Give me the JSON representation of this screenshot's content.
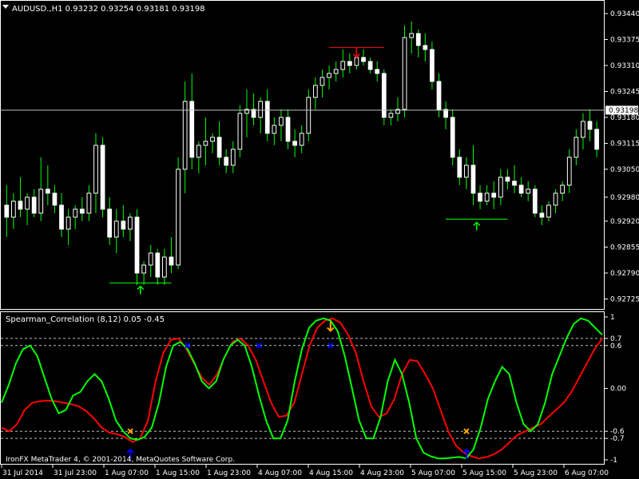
{
  "header": {
    "symbol_text": "AUDUSD.,H1  0.93232 0.93254 0.93181 0.93198"
  },
  "price_axis": {
    "ticks": [
      "0.93440",
      "0.93375",
      "0.93310",
      "0.93245",
      "0.93180",
      "0.93115",
      "0.93050",
      "0.92980",
      "0.92920",
      "0.92855",
      "0.92790",
      "0.92725"
    ],
    "current_price_label": "0.93198"
  },
  "indicator": {
    "title": "Spearman_Correlation (8,12) 0.05 -0.45",
    "level_labels": [
      "1",
      "0.7",
      "0.6",
      "0.00",
      "-0.6",
      "-0.7",
      "-1"
    ],
    "copyright": "IronFX MetaTrader 4, © 2001-2014, MetaQuotes Software Corp."
  },
  "time_axis": {
    "labels": [
      "31 Jul 2014",
      "31 Jul 23:00",
      "1 Aug 07:00",
      "1 Aug 15:00",
      "1 Aug 23:00",
      "4 Aug 07:00",
      "4 Aug 15:00",
      "4 Aug 23:00",
      "5 Aug 07:00",
      "5 Aug 15:00",
      "5 Aug 23:00",
      "6 Aug 07:00"
    ]
  },
  "colors": {
    "background": "#000000",
    "candle_bull": "#ffffff",
    "candle_bear": "#ffffff",
    "wick": "#00ff00",
    "grid_line": "#ffffff",
    "green_line": "#00ff00",
    "red_line": "#ff0000",
    "marker_blue": "#0000ff",
    "marker_orange": "#ffa500",
    "signal_green": "#00ff00",
    "signal_red": "#ff0000"
  },
  "chart_data": {
    "type": "candlestick",
    "symbol": "AUDUSD.",
    "timeframe": "H1",
    "ylim": [
      0.927,
      0.9347
    ],
    "current_price": 0.93198,
    "candles": [
      {
        "o": 0.9296,
        "h": 0.9301,
        "l": 0.9288,
        "c": 0.9293
      },
      {
        "o": 0.9293,
        "h": 0.9299,
        "l": 0.929,
        "c": 0.9297
      },
      {
        "o": 0.9297,
        "h": 0.9303,
        "l": 0.9293,
        "c": 0.9295
      },
      {
        "o": 0.9295,
        "h": 0.9299,
        "l": 0.9291,
        "c": 0.9298
      },
      {
        "o": 0.9298,
        "h": 0.93,
        "l": 0.9293,
        "c": 0.9294
      },
      {
        "o": 0.9294,
        "h": 0.9308,
        "l": 0.9292,
        "c": 0.93
      },
      {
        "o": 0.93,
        "h": 0.9306,
        "l": 0.9296,
        "c": 0.9299
      },
      {
        "o": 0.9299,
        "h": 0.9301,
        "l": 0.9294,
        "c": 0.9296
      },
      {
        "o": 0.9296,
        "h": 0.9299,
        "l": 0.9288,
        "c": 0.929
      },
      {
        "o": 0.929,
        "h": 0.9295,
        "l": 0.9286,
        "c": 0.9293
      },
      {
        "o": 0.9293,
        "h": 0.9296,
        "l": 0.929,
        "c": 0.9295
      },
      {
        "o": 0.9295,
        "h": 0.9298,
        "l": 0.9292,
        "c": 0.9294
      },
      {
        "o": 0.9294,
        "h": 0.9301,
        "l": 0.9292,
        "c": 0.9299
      },
      {
        "o": 0.9299,
        "h": 0.9314,
        "l": 0.9294,
        "c": 0.9311
      },
      {
        "o": 0.9311,
        "h": 0.9313,
        "l": 0.9293,
        "c": 0.9295
      },
      {
        "o": 0.9295,
        "h": 0.9298,
        "l": 0.9286,
        "c": 0.9288
      },
      {
        "o": 0.9288,
        "h": 0.9295,
        "l": 0.9284,
        "c": 0.9292
      },
      {
        "o": 0.9292,
        "h": 0.9296,
        "l": 0.9288,
        "c": 0.929
      },
      {
        "o": 0.929,
        "h": 0.9294,
        "l": 0.9287,
        "c": 0.9293
      },
      {
        "o": 0.9293,
        "h": 0.9295,
        "l": 0.9276,
        "c": 0.9279
      },
      {
        "o": 0.9279,
        "h": 0.9282,
        "l": 0.9276,
        "c": 0.9281
      },
      {
        "o": 0.9281,
        "h": 0.9286,
        "l": 0.9278,
        "c": 0.9284
      },
      {
        "o": 0.9284,
        "h": 0.9285,
        "l": 0.9276,
        "c": 0.9278
      },
      {
        "o": 0.9278,
        "h": 0.9285,
        "l": 0.9276,
        "c": 0.9283
      },
      {
        "o": 0.9283,
        "h": 0.9288,
        "l": 0.9279,
        "c": 0.9281
      },
      {
        "o": 0.9281,
        "h": 0.9308,
        "l": 0.928,
        "c": 0.9305
      },
      {
        "o": 0.9305,
        "h": 0.9327,
        "l": 0.9299,
        "c": 0.9322
      },
      {
        "o": 0.9322,
        "h": 0.9329,
        "l": 0.9305,
        "c": 0.9308
      },
      {
        "o": 0.9308,
        "h": 0.9312,
        "l": 0.9304,
        "c": 0.9311
      },
      {
        "o": 0.9311,
        "h": 0.9318,
        "l": 0.9306,
        "c": 0.9312
      },
      {
        "o": 0.9312,
        "h": 0.9314,
        "l": 0.9309,
        "c": 0.9313
      },
      {
        "o": 0.9313,
        "h": 0.9317,
        "l": 0.9306,
        "c": 0.9308
      },
      {
        "o": 0.9308,
        "h": 0.931,
        "l": 0.9304,
        "c": 0.9306
      },
      {
        "o": 0.9306,
        "h": 0.9312,
        "l": 0.9304,
        "c": 0.931
      },
      {
        "o": 0.931,
        "h": 0.9321,
        "l": 0.9308,
        "c": 0.9319
      },
      {
        "o": 0.9319,
        "h": 0.9325,
        "l": 0.9313,
        "c": 0.932
      },
      {
        "o": 0.932,
        "h": 0.9324,
        "l": 0.9316,
        "c": 0.9318
      },
      {
        "o": 0.9318,
        "h": 0.9323,
        "l": 0.9314,
        "c": 0.9322
      },
      {
        "o": 0.9322,
        "h": 0.9325,
        "l": 0.9312,
        "c": 0.9314
      },
      {
        "o": 0.9314,
        "h": 0.9318,
        "l": 0.9311,
        "c": 0.9316
      },
      {
        "o": 0.9316,
        "h": 0.932,
        "l": 0.9312,
        "c": 0.9318
      },
      {
        "o": 0.9318,
        "h": 0.932,
        "l": 0.931,
        "c": 0.9312
      },
      {
        "o": 0.9312,
        "h": 0.9315,
        "l": 0.9308,
        "c": 0.9311
      },
      {
        "o": 0.9311,
        "h": 0.9316,
        "l": 0.9309,
        "c": 0.9314
      },
      {
        "o": 0.9314,
        "h": 0.9325,
        "l": 0.9312,
        "c": 0.9323
      },
      {
        "o": 0.9323,
        "h": 0.9328,
        "l": 0.932,
        "c": 0.9326
      },
      {
        "o": 0.9326,
        "h": 0.933,
        "l": 0.9323,
        "c": 0.9328
      },
      {
        "o": 0.9328,
        "h": 0.9331,
        "l": 0.9325,
        "c": 0.9329
      },
      {
        "o": 0.9329,
        "h": 0.9332,
        "l": 0.9327,
        "c": 0.933
      },
      {
        "o": 0.933,
        "h": 0.9335,
        "l": 0.9328,
        "c": 0.9332
      },
      {
        "o": 0.9332,
        "h": 0.9334,
        "l": 0.9329,
        "c": 0.9331
      },
      {
        "o": 0.9331,
        "h": 0.9334,
        "l": 0.933,
        "c": 0.9333
      },
      {
        "o": 0.9333,
        "h": 0.9335,
        "l": 0.9331,
        "c": 0.9332
      },
      {
        "o": 0.9332,
        "h": 0.9333,
        "l": 0.9329,
        "c": 0.933
      },
      {
        "o": 0.933,
        "h": 0.9332,
        "l": 0.9327,
        "c": 0.9329
      },
      {
        "o": 0.9329,
        "h": 0.933,
        "l": 0.9316,
        "c": 0.9318
      },
      {
        "o": 0.9318,
        "h": 0.932,
        "l": 0.9316,
        "c": 0.9319
      },
      {
        "o": 0.9319,
        "h": 0.9323,
        "l": 0.9317,
        "c": 0.932
      },
      {
        "o": 0.932,
        "h": 0.9341,
        "l": 0.9318,
        "c": 0.9338
      },
      {
        "o": 0.9338,
        "h": 0.9342,
        "l": 0.9334,
        "c": 0.9339
      },
      {
        "o": 0.9339,
        "h": 0.934,
        "l": 0.9333,
        "c": 0.9336
      },
      {
        "o": 0.9336,
        "h": 0.9339,
        "l": 0.9332,
        "c": 0.9335
      },
      {
        "o": 0.9335,
        "h": 0.9337,
        "l": 0.9325,
        "c": 0.9327
      },
      {
        "o": 0.9327,
        "h": 0.9329,
        "l": 0.9318,
        "c": 0.932
      },
      {
        "o": 0.932,
        "h": 0.9322,
        "l": 0.9315,
        "c": 0.9318
      },
      {
        "o": 0.9318,
        "h": 0.932,
        "l": 0.9306,
        "c": 0.9308
      },
      {
        "o": 0.9308,
        "h": 0.931,
        "l": 0.9301,
        "c": 0.9303
      },
      {
        "o": 0.9303,
        "h": 0.9308,
        "l": 0.93,
        "c": 0.9306
      },
      {
        "o": 0.9306,
        "h": 0.9311,
        "l": 0.9296,
        "c": 0.9299
      },
      {
        "o": 0.9299,
        "h": 0.9301,
        "l": 0.9295,
        "c": 0.9297
      },
      {
        "o": 0.9297,
        "h": 0.9301,
        "l": 0.9296,
        "c": 0.9299
      },
      {
        "o": 0.9299,
        "h": 0.9302,
        "l": 0.9295,
        "c": 0.9298
      },
      {
        "o": 0.9298,
        "h": 0.9305,
        "l": 0.9296,
        "c": 0.9303
      },
      {
        "o": 0.9303,
        "h": 0.9305,
        "l": 0.93,
        "c": 0.9302
      },
      {
        "o": 0.9302,
        "h": 0.9306,
        "l": 0.9299,
        "c": 0.9301
      },
      {
        "o": 0.9301,
        "h": 0.9303,
        "l": 0.9298,
        "c": 0.9299
      },
      {
        "o": 0.9299,
        "h": 0.9302,
        "l": 0.9297,
        "c": 0.93
      },
      {
        "o": 0.93,
        "h": 0.9301,
        "l": 0.9293,
        "c": 0.9294
      },
      {
        "o": 0.9294,
        "h": 0.9296,
        "l": 0.9291,
        "c": 0.9293
      },
      {
        "o": 0.9293,
        "h": 0.9297,
        "l": 0.9292,
        "c": 0.9296
      },
      {
        "o": 0.9296,
        "h": 0.93,
        "l": 0.9294,
        "c": 0.9299
      },
      {
        "o": 0.9299,
        "h": 0.9302,
        "l": 0.9297,
        "c": 0.9301
      },
      {
        "o": 0.9301,
        "h": 0.931,
        "l": 0.9299,
        "c": 0.9308
      },
      {
        "o": 0.9308,
        "h": 0.9315,
        "l": 0.9306,
        "c": 0.9313
      },
      {
        "o": 0.9313,
        "h": 0.9319,
        "l": 0.931,
        "c": 0.9317
      },
      {
        "o": 0.9317,
        "h": 0.932,
        "l": 0.9312,
        "c": 0.9315
      },
      {
        "o": 0.9315,
        "h": 0.9317,
        "l": 0.9308,
        "c": 0.931
      }
    ],
    "indicator": {
      "name": "Spearman_Correlation",
      "ylim": [
        -1,
        1
      ],
      "levels": [
        0.7,
        0.6,
        -0.6,
        -0.7
      ],
      "green": [
        -0.2,
        0.05,
        0.35,
        0.55,
        0.6,
        0.45,
        0.15,
        -0.15,
        -0.35,
        -0.3,
        -0.1,
        -0.05,
        0.1,
        0.2,
        0.1,
        -0.15,
        -0.45,
        -0.6,
        -0.7,
        -0.72,
        -0.68,
        -0.55,
        -0.2,
        0.3,
        0.6,
        0.65,
        0.55,
        0.35,
        0.1,
        0.0,
        0.1,
        0.4,
        0.6,
        0.68,
        0.6,
        0.3,
        -0.1,
        -0.45,
        -0.7,
        -0.7,
        -0.45,
        0.1,
        0.55,
        0.85,
        0.95,
        0.98,
        0.95,
        0.8,
        0.45,
        0.0,
        -0.45,
        -0.7,
        -0.7,
        -0.4,
        0.1,
        0.4,
        0.2,
        -0.2,
        -0.7,
        -0.9,
        -0.95,
        -0.98,
        -0.98,
        -0.97,
        -0.96,
        -0.98,
        -0.85,
        -0.55,
        -0.15,
        0.1,
        0.3,
        0.2,
        -0.2,
        -0.5,
        -0.6,
        -0.5,
        -0.2,
        0.2,
        0.45,
        0.7,
        0.9,
        0.98,
        0.95,
        0.85,
        0.75
      ],
      "red": [
        -0.55,
        -0.6,
        -0.5,
        -0.3,
        -0.2,
        -0.18,
        -0.17,
        -0.18,
        -0.2,
        -0.22,
        -0.25,
        -0.32,
        -0.42,
        -0.55,
        -0.62,
        -0.64,
        -0.68,
        -0.75,
        -0.7,
        -0.45,
        0.1,
        0.5,
        0.68,
        0.7,
        0.55,
        0.35,
        0.15,
        0.05,
        0.2,
        0.45,
        0.65,
        0.7,
        0.6,
        0.4,
        0.1,
        -0.2,
        -0.4,
        -0.38,
        -0.2,
        0.2,
        0.6,
        0.85,
        0.95,
        0.98,
        0.92,
        0.75,
        0.5,
        0.1,
        -0.25,
        -0.4,
        -0.35,
        -0.15,
        0.2,
        0.4,
        0.38,
        0.2,
        0.0,
        -0.3,
        -0.6,
        -0.8,
        -0.9,
        -0.95,
        -0.98,
        -0.96,
        -0.92,
        -0.85,
        -0.75,
        -0.65,
        -0.6,
        -0.55,
        -0.5,
        -0.4,
        -0.3,
        -0.2,
        -0.05,
        0.15,
        0.35,
        0.55,
        0.7
      ],
      "markers": [
        {
          "type": "cross",
          "color": "orange",
          "index": 18,
          "value": -0.6
        },
        {
          "type": "arrow-up",
          "color": "blue",
          "index": 18,
          "value": -0.9
        },
        {
          "type": "cross",
          "color": "blue",
          "index": 26,
          "value": 0.6
        },
        {
          "type": "cross",
          "color": "blue",
          "index": 36,
          "value": 0.6
        },
        {
          "type": "arrow-down",
          "color": "orange",
          "index": 46,
          "value": 0.85
        },
        {
          "type": "cross",
          "color": "blue",
          "index": 46,
          "value": 0.6
        },
        {
          "type": "cross",
          "color": "orange",
          "index": 65,
          "value": -0.6
        },
        {
          "type": "arrow-up",
          "color": "blue",
          "index": 65,
          "value": -0.9
        }
      ]
    },
    "signals": [
      {
        "type": "buy",
        "price": 0.92765,
        "from_index": 15,
        "to_index": 24
      },
      {
        "type": "sell",
        "price": 0.93355,
        "from_index": 47,
        "to_index": 55
      },
      {
        "type": "buy",
        "price": 0.92925,
        "from_index": 64,
        "to_index": 73
      }
    ]
  }
}
